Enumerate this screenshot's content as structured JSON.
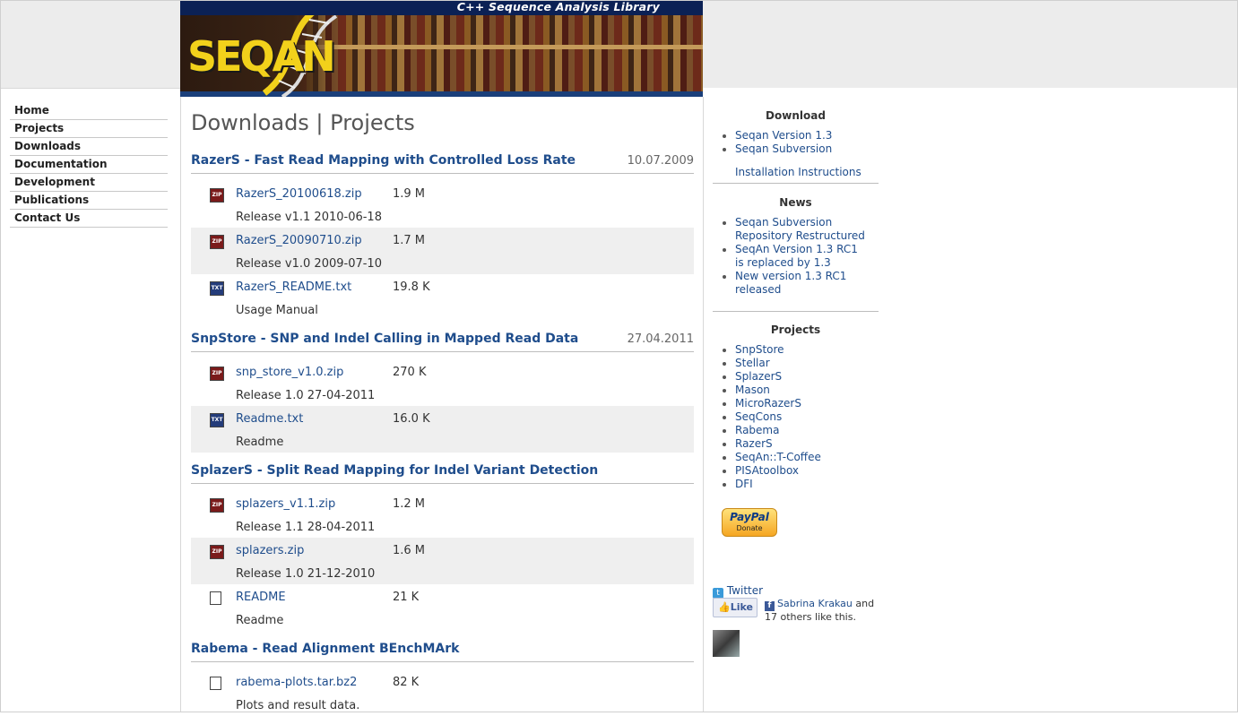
{
  "header": {
    "tagline": "C++ Sequence Analysis Library",
    "logo_text": "SEQAN"
  },
  "nav": {
    "items": [
      {
        "label": "Home"
      },
      {
        "label": "Projects"
      },
      {
        "label": "Downloads"
      },
      {
        "label": "Documentation"
      },
      {
        "label": "Development"
      },
      {
        "label": "Publications"
      },
      {
        "label": "Contact Us"
      }
    ]
  },
  "main": {
    "title": "Downloads | Projects",
    "sections": [
      {
        "title": "RazerS - Fast Read Mapping with Controlled Loss Rate",
        "date": "10.07.2009",
        "files": [
          {
            "name": "RazerS_20100618.zip",
            "size": "1.9 M",
            "desc": "Release v1.1 2010-06-18",
            "icon": "zip-file-icon"
          },
          {
            "name": "RazerS_20090710.zip",
            "size": "1.7 M",
            "desc": "Release v1.0 2009-07-10",
            "icon": "zip-file-icon"
          },
          {
            "name": "RazerS_README.txt",
            "size": "19.8 K",
            "desc": "Usage Manual",
            "icon": "txt-file-icon"
          }
        ]
      },
      {
        "title": "SnpStore - SNP and Indel Calling in Mapped Read Data",
        "date": "27.04.2011",
        "files": [
          {
            "name": "snp_store_v1.0.zip",
            "size": "270 K",
            "desc": "Release 1.0 27-04-2011",
            "icon": "zip-file-icon"
          },
          {
            "name": "Readme.txt",
            "size": "16.0 K",
            "desc": "Readme",
            "icon": "txt-file-icon"
          }
        ]
      },
      {
        "title": "SplazerS - Split Read Mapping for Indel Variant Detection",
        "date": "",
        "files": [
          {
            "name": "splazers_v1.1.zip",
            "size": "1.2 M",
            "desc": "Release 1.1 28-04-2011",
            "icon": "zip-file-icon"
          },
          {
            "name": "splazers.zip",
            "size": "1.6 M",
            "desc": "Release 1.0 21-12-2010",
            "icon": "zip-file-icon"
          },
          {
            "name": "README",
            "size": "21 K",
            "desc": "Readme",
            "icon": "blank-file-icon"
          }
        ]
      },
      {
        "title": "Rabema - Read Alignment BEnchMArk",
        "date": "",
        "files": [
          {
            "name": "rabema-plots.tar.bz2",
            "size": "82 K",
            "desc": "Plots and result data.",
            "icon": "blank-file-icon"
          }
        ]
      }
    ]
  },
  "sidebar": {
    "download": {
      "heading": "Download",
      "items": [
        "Seqan Version 1.3",
        "Seqan Subversion"
      ],
      "install": "Installation Instructions"
    },
    "news": {
      "heading": "News",
      "items": [
        "Seqan Subversion Repository Restructured",
        "SeqAn Version 1.3 RC1 is replaced by 1.3",
        "New version 1.3 RC1 released"
      ]
    },
    "projects": {
      "heading": "Projects",
      "items": [
        "SnpStore",
        "Stellar",
        "SplazerS",
        "Mason",
        "MicroRazerS",
        "SeqCons",
        "Rabema",
        "RazerS",
        "SeqAn::T-Coffee",
        "PISAtoolbox",
        "DFI"
      ]
    },
    "paypal": {
      "brand": "PayPal",
      "label": "Donate"
    },
    "twitter": "Twitter",
    "like": {
      "button": "Like",
      "name": "Sabrina Krakau",
      "rest": " and 17 others like this."
    }
  },
  "colors": {
    "link": "#1f4d8c",
    "banner_strip": "#0b2155",
    "logo": "#f2d11b",
    "shade": "#efefef"
  }
}
